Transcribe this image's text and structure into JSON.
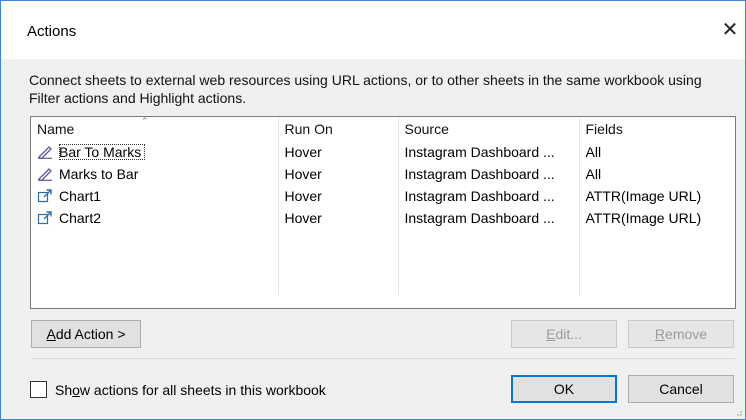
{
  "dialog": {
    "title": "Actions",
    "close_icon": "close-icon",
    "description": "Connect sheets to external web resources using URL actions, or to other sheets in the same workbook using Filter actions and Highlight actions."
  },
  "table": {
    "columns": [
      "Name",
      "Run On",
      "Source",
      "Fields"
    ],
    "rows": [
      {
        "icon": "highlight-action-icon",
        "name": "Bar To Marks",
        "run_on": "Hover",
        "source": "Instagram Dashboard ...",
        "fields": "All"
      },
      {
        "icon": "highlight-action-icon",
        "name": "Marks to Bar",
        "run_on": "Hover",
        "source": "Instagram Dashboard ...",
        "fields": "All"
      },
      {
        "icon": "url-action-icon",
        "name": "Chart1",
        "run_on": "Hover",
        "source": "Instagram Dashboard ...",
        "fields": "ATTR(Image URL)"
      },
      {
        "icon": "url-action-icon",
        "name": "Chart2",
        "run_on": "Hover",
        "source": "Instagram Dashboard ...",
        "fields": "ATTR(Image URL)"
      }
    ]
  },
  "buttons": {
    "add_action": "Add Action >",
    "edit": "Edit...",
    "remove": "Remove",
    "ok": "OK",
    "cancel": "Cancel"
  },
  "footer": {
    "show_all_label": "Show actions for all sheets in this workbook",
    "show_all_checked": false
  },
  "colors": {
    "accent": "#0078d7",
    "window_border": "#3b86d6",
    "highlight_icon": "#5a5a9a",
    "url_icon": "#2a6fb0"
  }
}
